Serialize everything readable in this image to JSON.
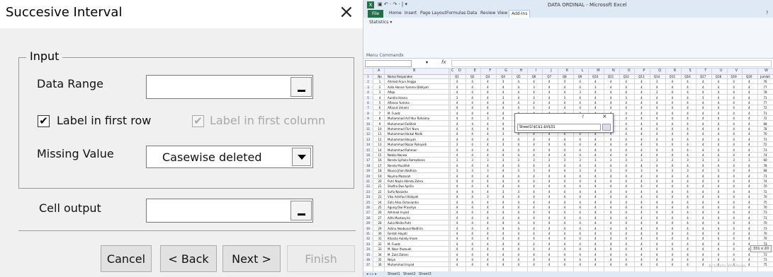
{
  "dialog": {
    "title": "Succesive Interval",
    "close_glyph": "×",
    "group_title": "Input",
    "data_range_label": "Data Range",
    "label_first_row": "Label in first row",
    "label_first_row_checked": true,
    "label_first_column": "Label in first column",
    "label_first_column_checked": true,
    "label_first_column_disabled": true,
    "missing_value_label": "Missing Value",
    "missing_value_selected": "Casewise deleted",
    "cell_output_label": "Cell output",
    "buttons": {
      "cancel": "Cancel",
      "back": "< Back",
      "next": "Next >",
      "finish": "Finish"
    },
    "check_glyph": "✔"
  },
  "excel": {
    "title": "DATA ORDINAL - Microsoft Excel",
    "logo": "X",
    "quick_access": "▣ ↶ · ↷ · | ▾",
    "tabs": [
      "File",
      "Home",
      "Insert",
      "Page Layout",
      "Formulas",
      "Data",
      "Review",
      "View",
      "Add-Ins"
    ],
    "active_tab": "Add-Ins",
    "help_icon": "?",
    "ribbon_statistics": "Statistics ▾",
    "menu_commands": "Menu Commands",
    "name_box_arrow": "▾",
    "fx": "fx",
    "columns": [
      "A",
      "B",
      "C",
      "D",
      "E",
      "F",
      "G",
      "H",
      "I",
      "J",
      "K",
      "L",
      "M",
      "N",
      "O",
      "P",
      "Q",
      "R",
      "S",
      "T",
      "U",
      "V",
      "W"
    ],
    "header_row": {
      "no": "No",
      "name": "Nama Responden",
      "questions": [
        "Q1",
        "Q2",
        "Q3",
        "Q4",
        "Q5",
        "Q6",
        "Q7",
        "Q8",
        "Q9",
        "Q10",
        "Q11",
        "Q12",
        "Q13",
        "Q14",
        "Q15",
        "Q16",
        "Q17",
        "Q18",
        "Q19",
        "Q20"
      ],
      "total": "Jumlah"
    },
    "rows": [
      {
        "r": "2",
        "no": "1",
        "name": "Ahmad Arjun Angga",
        "v": [
          "4",
          "4",
          "4",
          "3",
          "4",
          "4",
          "4",
          "3",
          "4",
          "4",
          "4",
          "4",
          "4",
          "3",
          "4",
          "4",
          "4",
          "4",
          "4",
          "4"
        ],
        "j": "76"
      },
      {
        "r": "3",
        "no": "2",
        "name": "Azila Hanna Yumma Qibtiyah",
        "v": [
          "4",
          "4",
          "4",
          "4",
          "4",
          "3",
          "4",
          "4",
          "4",
          "3",
          "4",
          "4",
          "4",
          "4",
          "4",
          "4",
          "4",
          "4",
          "4",
          "4"
        ],
        "j": "77"
      },
      {
        "r": "4",
        "no": "3",
        "name": "Afiqa",
        "v": [
          "4",
          "4",
          "4",
          "4",
          "4",
          "4",
          "4",
          "4",
          "3",
          "4",
          "4",
          "4",
          "4",
          "3",
          "4",
          "4",
          "4",
          "4",
          "4",
          "4"
        ],
        "j": "78"
      },
      {
        "r": "5",
        "no": "4",
        "name": "Aurelia Hasna",
        "v": [
          "3",
          "4",
          "4",
          "3",
          "4",
          "3",
          "4",
          "3",
          "4",
          "4",
          "4",
          "3",
          "4",
          "4",
          "4",
          "4",
          "3",
          "4",
          "4",
          "4"
        ],
        "j": "71"
      },
      {
        "r": "6",
        "no": "5",
        "name": "Afianas Yumma",
        "v": [
          "4",
          "4",
          "4",
          "4",
          "4",
          "4",
          "4",
          "4",
          "4",
          "4",
          "4",
          "4",
          "4",
          "4",
          "4",
          "4",
          "4",
          "4",
          "4",
          "4"
        ],
        "j": "77"
      },
      {
        "r": "7",
        "no": "6",
        "name": "Afianut Umami",
        "v": [
          "4",
          "4",
          "4",
          "4",
          "4",
          "4",
          "4",
          "4",
          "4",
          "4",
          "4",
          "4",
          "4",
          "4",
          "4",
          "4",
          "4",
          "4",
          "4",
          "4"
        ],
        "j": "72"
      },
      {
        "r": "8",
        "no": "7",
        "name": "M. Fuadz",
        "v": [
          "4",
          "4",
          "4",
          "4",
          "4",
          "4",
          "4",
          "4",
          "4",
          "4",
          "4",
          "4",
          "4",
          "4",
          "4",
          "4",
          "4",
          "4",
          "4",
          "4"
        ],
        "j": "73"
      },
      {
        "r": "9",
        "no": "8",
        "name": "Muhammad Arif Nur Rohaima",
        "v": [
          "4",
          "4",
          "3",
          "4",
          "3",
          "4",
          "4",
          "4",
          "4",
          "4",
          "4",
          "4",
          "4",
          "4",
          "4",
          "4",
          "4",
          "4",
          "4",
          "4"
        ],
        "j": "72"
      },
      {
        "r": "10",
        "no": "9",
        "name": "Muhammad Fadillah",
        "v": [
          "4",
          "4",
          "4",
          "4",
          "4",
          "4",
          "4",
          "4",
          "4",
          "4",
          "4",
          "4",
          "4",
          "4",
          "4",
          "4",
          "4",
          "4",
          "4",
          "4"
        ],
        "j": "68"
      },
      {
        "r": "11",
        "no": "10",
        "name": "Muhammad Fikri Nuro",
        "v": [
          "4",
          "4",
          "4",
          "4",
          "4",
          "4",
          "4",
          "4",
          "4",
          "4",
          "4",
          "4",
          "4",
          "4",
          "4",
          "4",
          "4",
          "4",
          "4",
          "4"
        ],
        "j": "78"
      },
      {
        "r": "12",
        "no": "11",
        "name": "Muhammad Haikal Malik",
        "v": [
          "4",
          "4",
          "4",
          "3",
          "4",
          "4",
          "4",
          "4",
          "4",
          "4",
          "4",
          "4",
          "4",
          "4",
          "4",
          "4",
          "4",
          "4",
          "4",
          "4"
        ],
        "j": "70"
      },
      {
        "r": "13",
        "no": "12",
        "name": "Muhammad Hasyah",
        "v": [
          "4",
          "4",
          "4",
          "4",
          "4",
          "4",
          "4",
          "4",
          "4",
          "4",
          "4",
          "4",
          "4",
          "4",
          "4",
          "4",
          "4",
          "4",
          "4",
          "4"
        ],
        "j": "73"
      },
      {
        "r": "14",
        "no": "13",
        "name": "Muhammad Nazar Rohiyadi",
        "v": [
          "3",
          "4",
          "4",
          "3",
          "4",
          "4",
          "4",
          "4",
          "4",
          "4",
          "4",
          "4",
          "4",
          "4",
          "4",
          "4",
          "4",
          "4",
          "4",
          "4"
        ],
        "j": "72"
      },
      {
        "r": "15",
        "no": "14",
        "name": "Muhammad Rahman",
        "v": [
          "4",
          "4",
          "4",
          "4",
          "4",
          "4",
          "4",
          "4",
          "4",
          "4",
          "4",
          "4",
          "4",
          "4",
          "4",
          "4",
          "4",
          "4",
          "4",
          "4"
        ],
        "j": "73"
      },
      {
        "r": "16",
        "no": "15",
        "name": "Nabila Nacwa",
        "v": [
          "4",
          "4",
          "4",
          "4",
          "4",
          "4",
          "4",
          "4",
          "4",
          "4",
          "4",
          "4",
          "4",
          "4",
          "4",
          "4",
          "4",
          "4",
          "4",
          "4"
        ],
        "j": "74"
      },
      {
        "r": "17",
        "no": "16",
        "name": "Nanda Syifaila Ramadania",
        "v": [
          "3",
          "3",
          "3",
          "3",
          "3",
          "3",
          "3",
          "3",
          "3",
          "3",
          "3",
          "3",
          "3",
          "3",
          "3",
          "3",
          "3",
          "3",
          "3",
          "3"
        ],
        "j": "60"
      },
      {
        "r": "18",
        "no": "17",
        "name": "Nanda Mualifah",
        "v": [
          "4",
          "4",
          "4",
          "4",
          "4",
          "4",
          "4",
          "4",
          "4",
          "4",
          "4",
          "4",
          "4",
          "4",
          "4",
          "4",
          "4",
          "4",
          "4",
          "4"
        ],
        "j": "78"
      },
      {
        "r": "19",
        "no": "18",
        "name": "Nauva Jihan Nadhira",
        "v": [
          "3",
          "3",
          "3",
          "4",
          "3",
          "3",
          "4",
          "4",
          "3",
          "4",
          "3",
          "4",
          "3",
          "4",
          "3",
          "3",
          "4",
          "3",
          "4",
          "4"
        ],
        "j": "68"
      },
      {
        "r": "20",
        "no": "19",
        "name": "Nayma Mazarah",
        "v": [
          "4",
          "4",
          "4",
          "4",
          "4",
          "4",
          "4",
          "4",
          "4",
          "4",
          "4",
          "4",
          "4",
          "4",
          "4",
          "4",
          "4",
          "4",
          "4",
          "4"
        ],
        "j": "73"
      },
      {
        "r": "21",
        "no": "20",
        "name": "Putri Nayla Adinda Zahra",
        "v": [
          "4",
          "4",
          "4",
          "4",
          "4",
          "4",
          "4",
          "4",
          "4",
          "4",
          "4",
          "4",
          "4",
          "4",
          "4",
          "4",
          "4",
          "4",
          "4",
          "4"
        ],
        "j": "74"
      },
      {
        "r": "22",
        "no": "21",
        "name": "Shafira Dwi Aprilia",
        "v": [
          "4",
          "4",
          "4",
          "4",
          "4",
          "4",
          "4",
          "4",
          "4",
          "4",
          "4",
          "4",
          "4",
          "4",
          "4",
          "4",
          "4",
          "4",
          "4",
          "4"
        ],
        "j": "70"
      },
      {
        "r": "23",
        "no": "22",
        "name": "Sufia Nasukha",
        "v": [
          "4",
          "4",
          "4",
          "3",
          "3",
          "4",
          "4",
          "4",
          "4",
          "4",
          "4",
          "4",
          "4",
          "4",
          "4",
          "4",
          "4",
          "4",
          "4",
          "4"
        ],
        "j": "72"
      },
      {
        "r": "24",
        "no": "23",
        "name": "Vika Ashifaul Hidayah",
        "v": [
          "4",
          "4",
          "3",
          "4",
          "4",
          "4",
          "4",
          "4",
          "4",
          "4",
          "4",
          "4",
          "4",
          "4",
          "4",
          "4",
          "4",
          "4",
          "4",
          "4"
        ],
        "j": "70"
      },
      {
        "r": "25",
        "no": "24",
        "name": "Zahi Alisa Octaviantia",
        "v": [
          "4",
          "4",
          "4",
          "4",
          "4",
          "4",
          "4",
          "4",
          "4",
          "4",
          "4",
          "4",
          "4",
          "4",
          "4",
          "4",
          "4",
          "4",
          "4",
          "4"
        ],
        "j": "75"
      },
      {
        "r": "26",
        "no": "25",
        "name": "Agung Dwi Prasetyo",
        "v": [
          "4",
          "4",
          "4",
          "4",
          "4",
          "4",
          "4",
          "4",
          "4",
          "4",
          "4",
          "4",
          "4",
          "4",
          "4",
          "4",
          "4",
          "4",
          "4",
          "4"
        ],
        "j": "70"
      },
      {
        "r": "27",
        "no": "26",
        "name": "Akhmad Irsyad",
        "v": [
          "4",
          "4",
          "4",
          "4",
          "4",
          "4",
          "4",
          "4",
          "4",
          "4",
          "4",
          "4",
          "4",
          "4",
          "4",
          "4",
          "4",
          "4",
          "4",
          "4"
        ],
        "j": "73"
      },
      {
        "r": "28",
        "no": "27",
        "name": "Alifa Mustasyira",
        "v": [
          "4",
          "4",
          "4",
          "4",
          "4",
          "4",
          "4",
          "4",
          "4",
          "4",
          "4",
          "4",
          "4",
          "4",
          "4",
          "4",
          "4",
          "4",
          "4",
          "4"
        ],
        "j": "73"
      },
      {
        "r": "29",
        "no": "28",
        "name": "Aulia Nikita Putri",
        "v": [
          "4",
          "4",
          "4",
          "4",
          "4",
          "4",
          "4",
          "4",
          "4",
          "4",
          "4",
          "4",
          "4",
          "4",
          "4",
          "4",
          "4",
          "4",
          "4",
          "4"
        ],
        "j": "70"
      },
      {
        "r": "30",
        "no": "29",
        "name": "Azlina Awabunal Nadhira",
        "v": [
          "4",
          "4",
          "4",
          "4",
          "4",
          "4",
          "4",
          "4",
          "4",
          "4",
          "4",
          "4",
          "4",
          "4",
          "4",
          "4",
          "4",
          "4",
          "4",
          "4"
        ],
        "j": "73"
      },
      {
        "r": "31",
        "no": "30",
        "name": "Fardah Hayati",
        "v": [
          "4",
          "4",
          "4",
          "4",
          "4",
          "4",
          "4",
          "4",
          "4",
          "4",
          "4",
          "4",
          "4",
          "4",
          "4",
          "4",
          "4",
          "4",
          "4",
          "4"
        ],
        "j": "70"
      },
      {
        "r": "32",
        "no": "31",
        "name": "Khanza Aulady Imam",
        "v": [
          "4",
          "4",
          "4",
          "4",
          "4",
          "4",
          "4",
          "4",
          "4",
          "4",
          "4",
          "4",
          "4",
          "4",
          "4",
          "4",
          "4",
          "4",
          "4",
          "4"
        ],
        "j": "70"
      },
      {
        "r": "33",
        "no": "32",
        "name": "M. Fuadz",
        "v": [
          "4",
          "4",
          "4",
          "4",
          "4",
          "4",
          "4",
          "4",
          "4",
          "4",
          "4",
          "4",
          "4",
          "4",
          "4",
          "4",
          "4",
          "4",
          "4",
          "4"
        ],
        "j": "73"
      },
      {
        "r": "34",
        "no": "33",
        "name": "M. Noor Ifazzuah",
        "v": [
          "4",
          "4",
          "4",
          "4",
          "4",
          "4",
          "4",
          "4",
          "4",
          "4",
          "4",
          "4",
          "4",
          "4",
          "4",
          "4",
          "4",
          "4",
          "4",
          "4"
        ],
        "j": "75"
      },
      {
        "r": "35",
        "no": "34",
        "name": "M. Zaid Zaileni",
        "v": [
          "4",
          "4",
          "4",
          "4",
          "4",
          "4",
          "4",
          "4",
          "4",
          "4",
          "4",
          "4",
          "4",
          "4",
          "4",
          "4",
          "4",
          "4",
          "4",
          "4"
        ],
        "j": "73"
      },
      {
        "r": "36",
        "no": "35",
        "name": "Nisya",
        "v": [
          "4",
          "4",
          "4",
          "4",
          "4",
          "4",
          "4",
          "4",
          "4",
          "4",
          "4",
          "4",
          "4",
          "4",
          "4",
          "4",
          "4",
          "4",
          "4",
          "4"
        ],
        "j": "73"
      },
      {
        "r": "37",
        "no": "36",
        "name": "Muhammad Irsyad",
        "v": [
          "4",
          "4",
          "4",
          "4",
          "4",
          "4",
          "4",
          "4",
          "4",
          "4",
          "4",
          "4",
          "4",
          "4",
          "4",
          "4",
          "4",
          "4",
          "4",
          "4"
        ],
        "j": "75"
      }
    ],
    "refedit": {
      "help": "?",
      "close": "×",
      "value": "Sheet1!$C$1:$V$31"
    },
    "sheet_tabs": [
      "Sheet1",
      "Sheet2",
      "Sheet3"
    ],
    "sheet_nav": "◂ ◃ ▹ ▸",
    "overlay_badge": "331 x 20",
    "watermark": "Activate Windows"
  }
}
